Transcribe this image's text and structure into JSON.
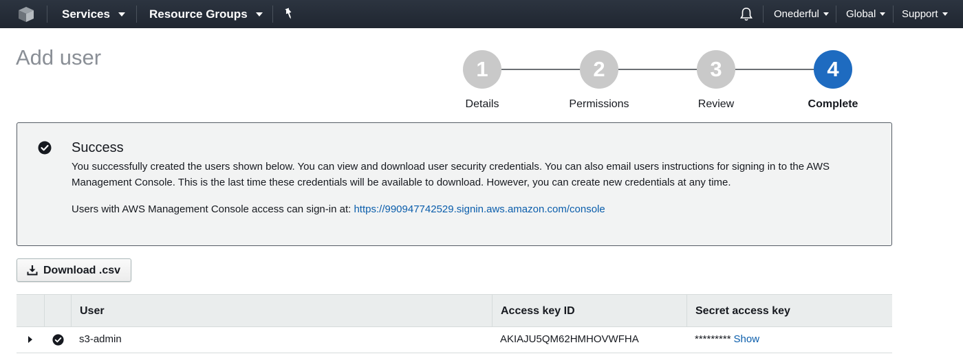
{
  "nav": {
    "services": "Services",
    "resource_groups": "Resource Groups",
    "account": "Onederful",
    "region": "Global",
    "support": "Support",
    "icons": [
      "aws-cube-icon",
      "pin-icon",
      "bell-icon"
    ]
  },
  "page": {
    "title": "Add user"
  },
  "wizard": {
    "steps": [
      {
        "number": "1",
        "label": "Details"
      },
      {
        "number": "2",
        "label": "Permissions"
      },
      {
        "number": "3",
        "label": "Review"
      },
      {
        "number": "4",
        "label": "Complete"
      }
    ],
    "active_step": 4,
    "active_color": "#1e6bc0",
    "inactive_color": "#c9c9c9"
  },
  "success": {
    "title": "Success",
    "message": "You successfully created the users shown below. You can view and download user security credentials. You can also email users instructions for signing in to the AWS Management Console. This is the last time these credentials will be available to download. However, you can create new credentials at any time.",
    "signin_prefix": "Users with AWS Management Console access can sign-in at:",
    "signin_url": "https://990947742529.signin.aws.amazon.com/console"
  },
  "download": {
    "label": "Download .csv"
  },
  "table": {
    "columns": [
      "User",
      "Access key ID",
      "Secret access key"
    ],
    "rows": [
      {
        "user": "s3-admin",
        "access_key_id": "AKIAJU5QM62HMHOVWFHA",
        "secret": "*********",
        "show_label": "Show"
      }
    ]
  },
  "colors": {
    "link": "#0a5dab",
    "nav_bg": "#232f3e"
  }
}
